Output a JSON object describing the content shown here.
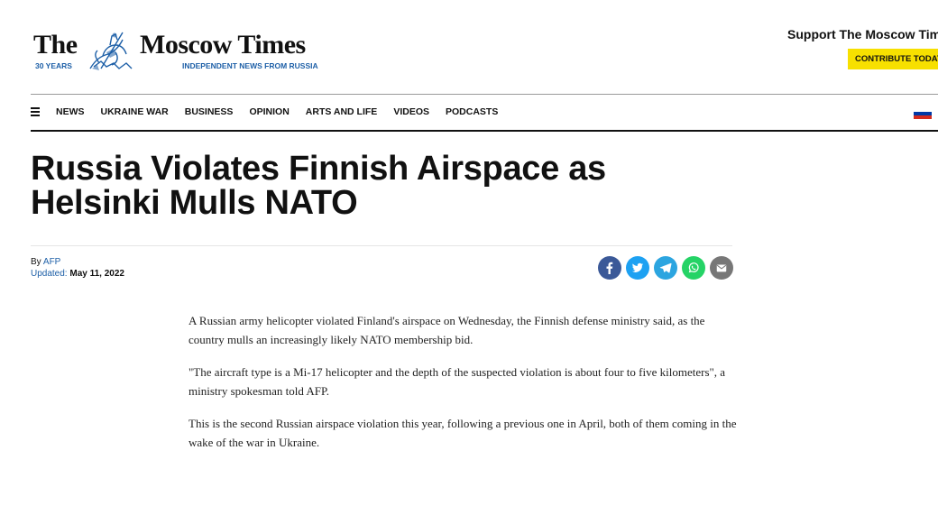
{
  "header": {
    "logo_the": "The",
    "logo_moscow_times": "Moscow Times",
    "logo_years": "30 YEARS",
    "logo_tagline": "INDEPENDENT NEWS FROM RUSSIA",
    "support_text": "Support The Moscow Times",
    "contribute_label": "CONTRIBUTE TODAY"
  },
  "nav": {
    "menu_icon": "hamburger-icon",
    "items": [
      "NEWS",
      "UKRAINE WAR",
      "BUSINESS",
      "OPINION",
      "ARTS AND LIFE",
      "VIDEOS",
      "PODCASTS"
    ],
    "flag_colors": [
      "#ffffff",
      "#0039a6",
      "#d52b1e"
    ]
  },
  "article": {
    "headline": "Russia Violates Finnish Airspace as Helsinki Mulls NATO",
    "by_label": "By",
    "author": "AFP",
    "updated_label": "Updated:",
    "updated_date": "May 11, 2022",
    "share": [
      {
        "name": "facebook-icon",
        "color": "#3b5998"
      },
      {
        "name": "twitter-icon",
        "color": "#1da1f2"
      },
      {
        "name": "telegram-icon",
        "color": "#2ca5e0"
      },
      {
        "name": "whatsapp-icon",
        "color": "#25d366"
      },
      {
        "name": "email-icon",
        "color": "#777777"
      }
    ],
    "paragraphs": [
      "A Russian army helicopter violated Finland's airspace on Wednesday, the Finnish defense ministry said, as the country mulls an increasingly likely NATO membership bid.",
      "\"The aircraft type is a Mi-17 helicopter and the depth of the suspected violation is about four to five kilometers\", a ministry spokesman told AFP.",
      "This is the second Russian airspace violation this year, following a previous one in April, both of them coming in the wake of the war in Ukraine."
    ]
  }
}
